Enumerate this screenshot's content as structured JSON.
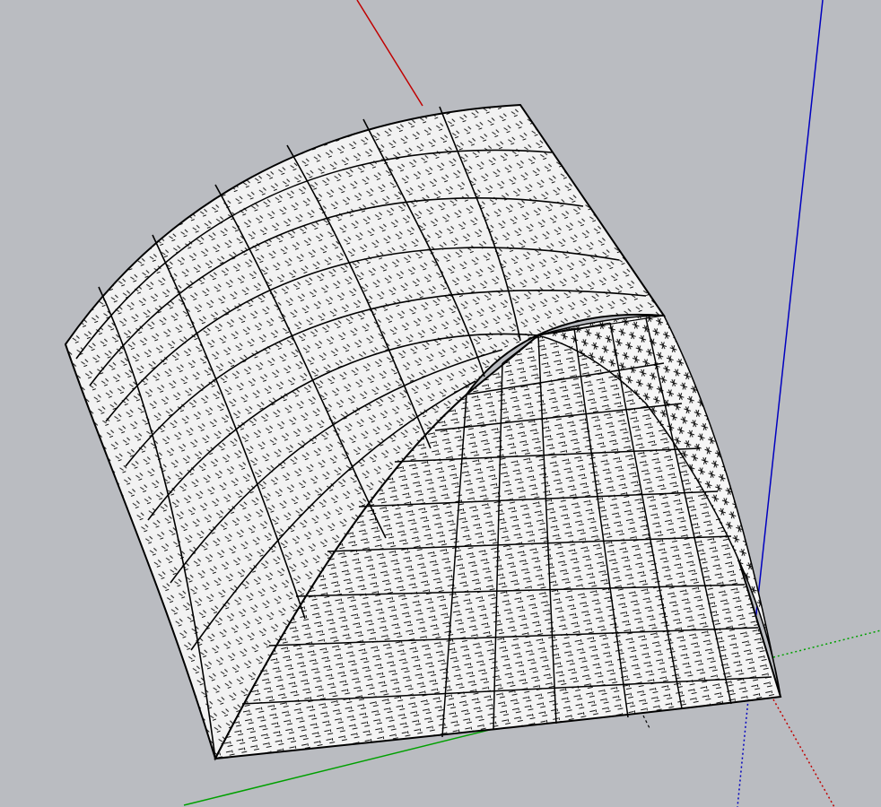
{
  "viewport": {
    "background_color": "#babcc1",
    "face_color": "#f2f2f2",
    "edge_color": "#000000"
  },
  "axes": {
    "red_color": "#c00000",
    "green_color": "#00a000",
    "blue_color": "#0000c0"
  },
  "model": {
    "shape": "quarter curved solid with triangulated mesh faces",
    "faces": [
      "top-curved-face",
      "front-flat-face",
      "right-curved-face"
    ]
  }
}
